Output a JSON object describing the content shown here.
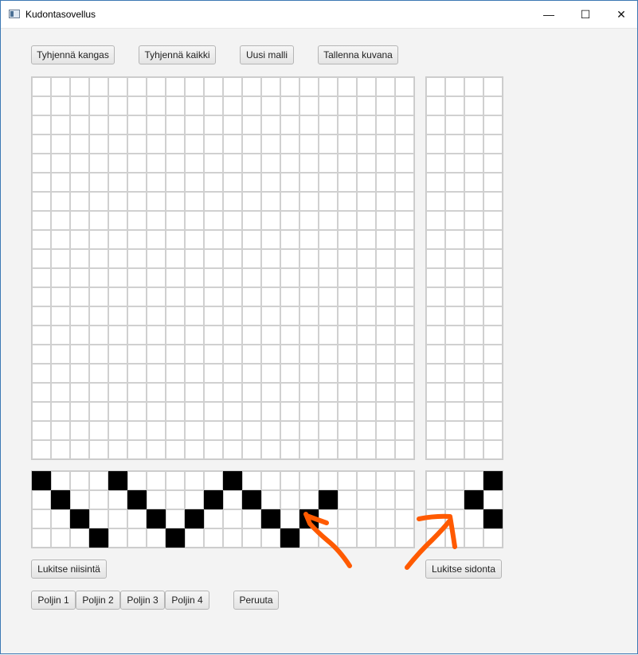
{
  "window": {
    "title": "Kudontasovellus",
    "min": "—",
    "max": "☐",
    "close": "✕"
  },
  "toolbar": {
    "clear_fabric": "Tyhjennä kangas",
    "clear_all": "Tyhjennä kaikki",
    "new_pattern": "Uusi malli",
    "save_image": "Tallenna kuvana"
  },
  "threading": {
    "cols": 20,
    "rows": 4,
    "filled": [
      [
        0,
        0
      ],
      [
        1,
        1
      ],
      [
        2,
        2
      ],
      [
        3,
        3
      ],
      [
        0,
        4
      ],
      [
        1,
        5
      ],
      [
        2,
        6
      ],
      [
        3,
        7
      ],
      [
        2,
        8
      ],
      [
        1,
        9
      ],
      [
        0,
        10
      ],
      [
        1,
        11
      ],
      [
        2,
        12
      ],
      [
        3,
        13
      ],
      [
        2,
        14
      ],
      [
        1,
        15
      ]
    ]
  },
  "tieup": {
    "cols": 4,
    "rows": 4,
    "filled": [
      [
        0,
        3
      ],
      [
        1,
        2
      ],
      [
        2,
        3
      ]
    ]
  },
  "fabric": {
    "cols": 20,
    "rows": 20
  },
  "treadling": {
    "cols": 4,
    "rows": 20
  },
  "buttons": {
    "lock_threading": "Lukitse niisintä",
    "lock_tieup": "Lukitse sidonta",
    "undo": "Peruuta"
  },
  "treadles": [
    "Poljin 1",
    "Poljin 2",
    "Poljin 3",
    "Poljin 4"
  ],
  "colors": {
    "annotation": "#ff5a00",
    "filled": "#000000"
  }
}
